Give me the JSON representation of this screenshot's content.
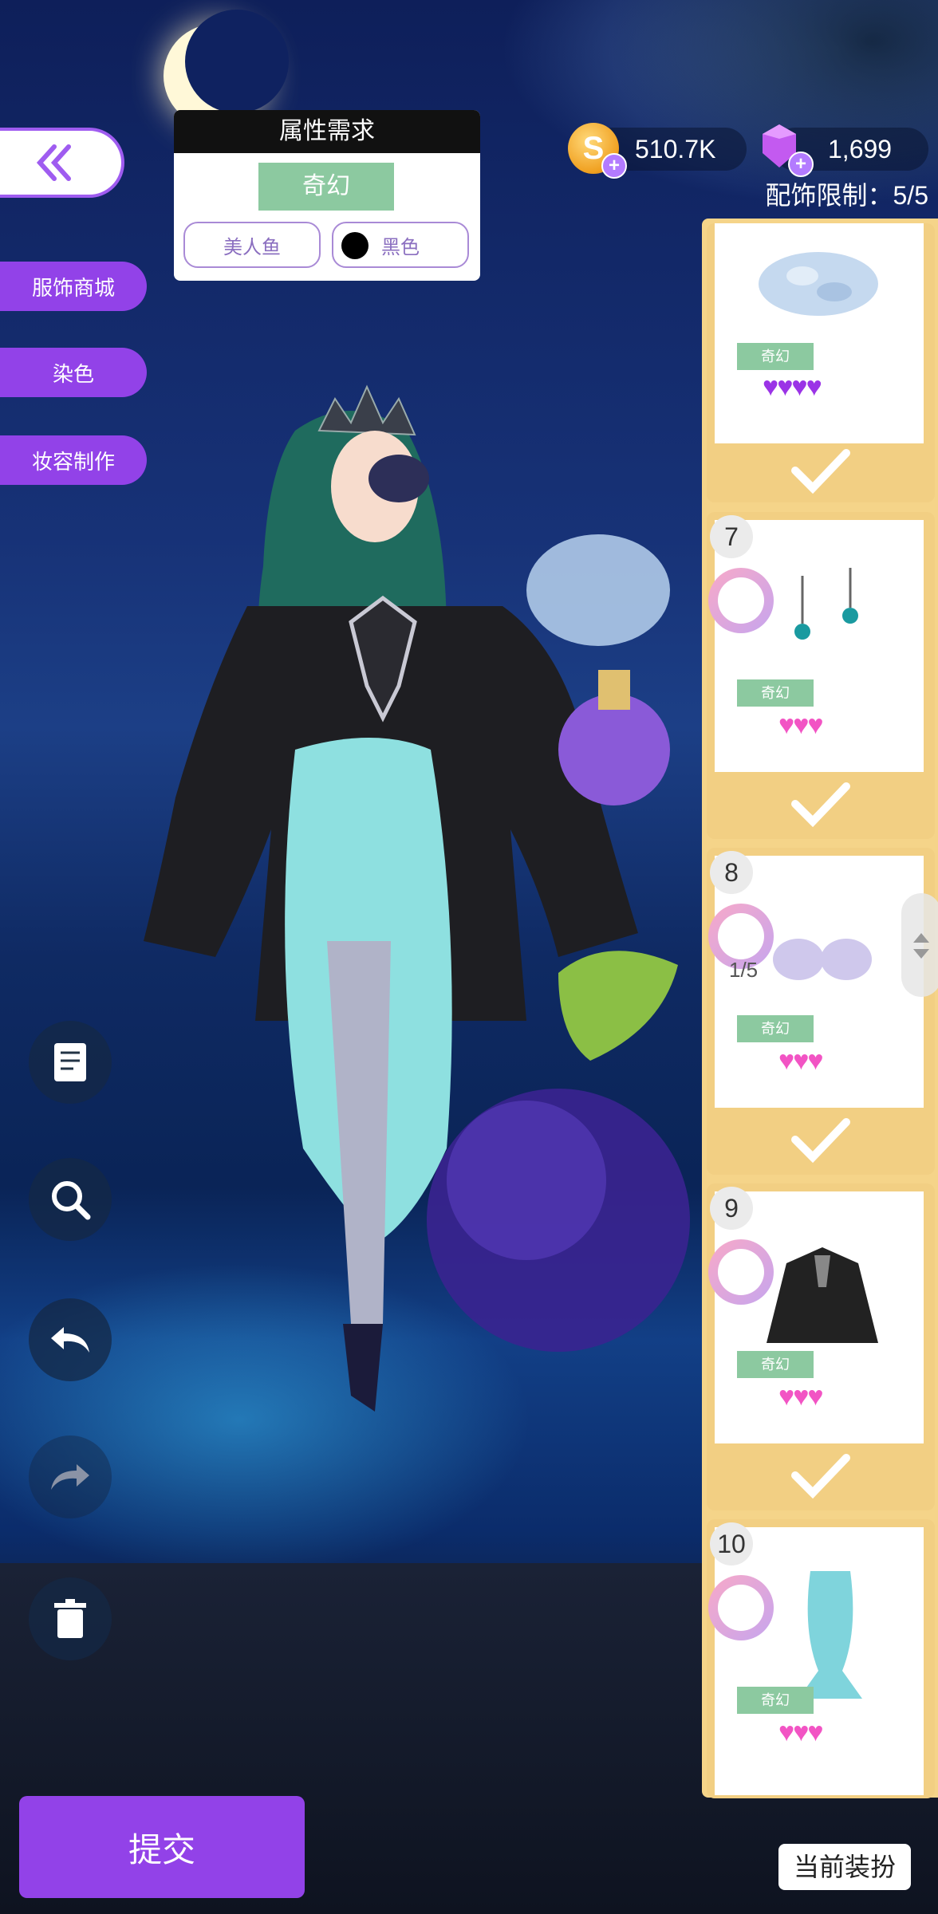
{
  "requirement": {
    "title": "属性需求",
    "main_tag": "奇幻",
    "tag1": "美人鱼",
    "tag2": "黑色"
  },
  "side_menu": [
    "服饰商城",
    "染色",
    "妆容制作"
  ],
  "currency": {
    "coins": "510.7K",
    "gems": "1,699"
  },
  "accessory_limit": "配饰限制：5/5",
  "items": [
    {
      "num": "",
      "tag": "奇幻",
      "hearts": "♥♥♥♥",
      "heart_color": "#9b33e6",
      "selected": true,
      "icon": "crystal-shells-icon"
    },
    {
      "num": "7",
      "tag": "奇幻",
      "hearts": "♥♥♥",
      "heart_color": "#f254c4",
      "selected": true,
      "icon": "earrings-icon"
    },
    {
      "num": "8",
      "tag": "奇幻",
      "hearts": "♥♥♥",
      "heart_color": "#f254c4",
      "selected": true,
      "fraction": "1/5",
      "icon": "shell-top-icon"
    },
    {
      "num": "9",
      "tag": "奇幻",
      "hearts": "♥♥♥",
      "heart_color": "#f254c4",
      "selected": true,
      "icon": "black-cloak-icon"
    },
    {
      "num": "10",
      "tag": "奇幻",
      "hearts": "♥♥♥",
      "heart_color": "#f254c4",
      "selected": false,
      "icon": "mermaid-skirt-icon"
    }
  ],
  "tools": [
    "notes-icon",
    "zoom-icon",
    "undo-icon",
    "redo-icon",
    "trash-icon"
  ],
  "submit_label": "提交",
  "current_outfit_label": "当前装扮"
}
